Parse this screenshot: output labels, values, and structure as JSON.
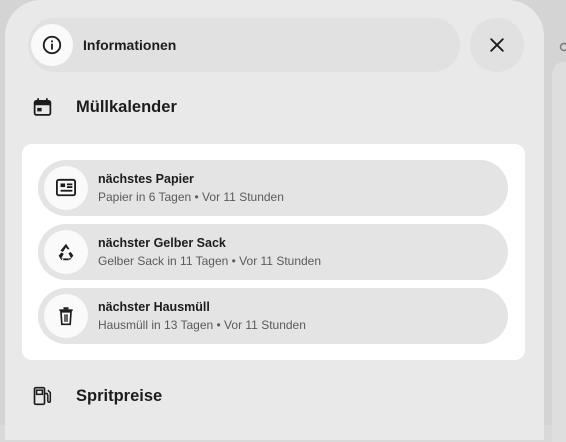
{
  "header": {
    "title": "Informationen",
    "info_icon": "info-icon",
    "close_icon": "close-icon"
  },
  "sections": [
    {
      "title": "Müllkalender",
      "icon": "calendar-icon"
    },
    {
      "title": "Spritpreise",
      "icon": "fuel-pump-icon"
    }
  ],
  "waste_calendar": {
    "items": [
      {
        "title": "nächstes Papier",
        "subtitle": "Papier in 6 Tagen • Vor 11 Stunden",
        "icon": "newspaper-icon"
      },
      {
        "title": "nächster Gelber Sack",
        "subtitle": "Gelber Sack in 11 Tagen • Vor 11 Stunden",
        "icon": "recycle-icon"
      },
      {
        "title": "nächster Hausmüll",
        "subtitle": "Hausmüll in 13 Tagen • Vor 11 Stunden",
        "icon": "trash-icon"
      }
    ]
  },
  "colors": {
    "dialog_bg": "#e9e9e9",
    "pill_bg": "#e1e1e1",
    "card_bg": "#ffffff",
    "text": "#1c1c1c",
    "secondary_text": "#5a5a5a"
  }
}
